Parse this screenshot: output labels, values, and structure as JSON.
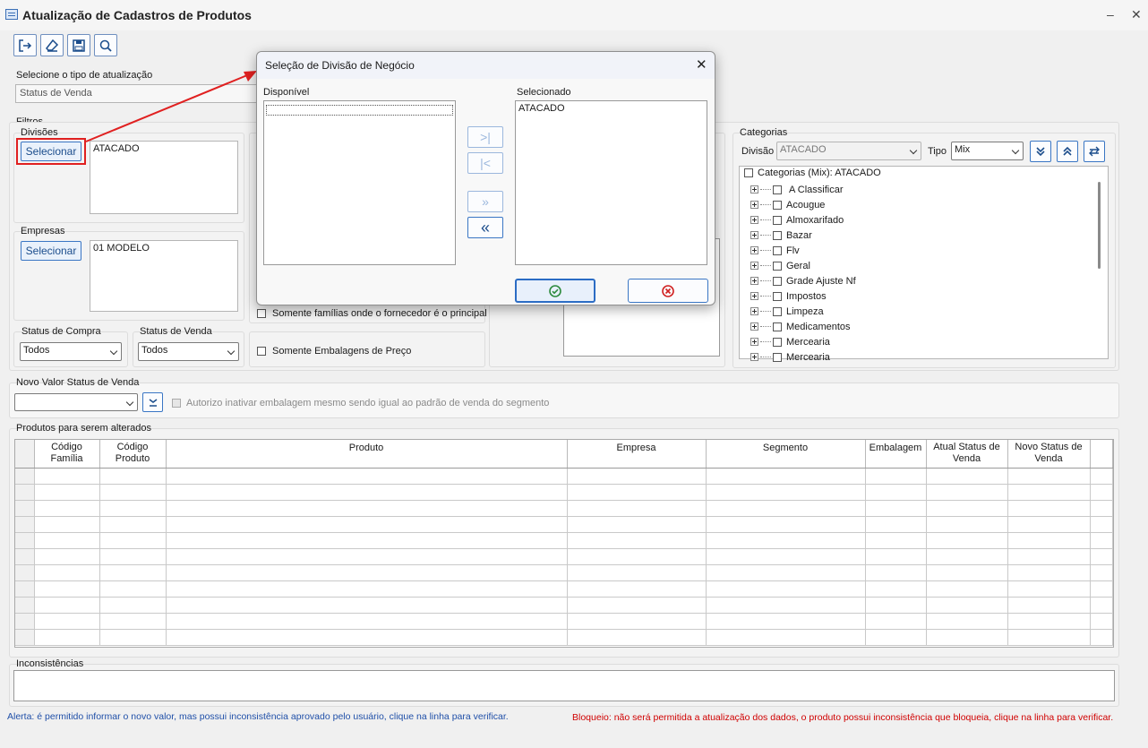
{
  "window": {
    "title": "Atualização de Cadastros de Produtos",
    "minimize": "–",
    "close": "✕"
  },
  "toolbar": {
    "icons": [
      "exit-icon",
      "eraser-icon",
      "save-icon",
      "search-icon"
    ]
  },
  "update_type": {
    "label": "Selecione o tipo de atualização",
    "value": "Status de Venda"
  },
  "filters": {
    "label": "Filtros",
    "divisions": {
      "label": "Divisões",
      "button": "Selecionar",
      "items": [
        "ATACADO"
      ]
    },
    "companies": {
      "label": "Empresas",
      "button": "Selecionar",
      "items": [
        "01 MODELO"
      ]
    },
    "purchase_status": {
      "label": "Status de Compra",
      "value": "Todos"
    },
    "sale_status": {
      "label": "Status de Venda",
      "value": "Todos"
    },
    "check_families": "Somente famílias onde o fornecedor é o principal",
    "check_packaging": "Somente Embalagens de Preço"
  },
  "categories": {
    "label": "Categorias",
    "division_label": "Divisão",
    "division_value": "ATACADO",
    "type_label": "Tipo",
    "type_value": "Mix",
    "root": "Categorias (Mix): ATACADO",
    "items": [
      "A Classificar",
      "Acougue",
      "Almoxarifado",
      "Bazar",
      "Flv",
      "Geral",
      "Grade Ajuste Nf",
      "Impostos",
      "Limpeza",
      "Medicamentos",
      "Mercearia",
      "Mercearia"
    ]
  },
  "new_value": {
    "label": "Novo Valor Status de Venda",
    "value": "",
    "check_label": "Autorizo inativar embalagem mesmo sendo igual ao padrão de venda do segmento"
  },
  "products": {
    "label": "Produtos para serem alterados",
    "columns": [
      "Código Família",
      "Código Produto",
      "Produto",
      "Empresa",
      "Segmento",
      "Embalagem",
      "Atual Status de Venda",
      "Novo Status de Venda"
    ],
    "row_count": 11
  },
  "inconsistencies": {
    "label": "Inconsistências"
  },
  "footer": {
    "alert": "Alerta: é permitido informar o novo valor, mas possui inconsistência aprovado pelo usuário, clique na linha para verificar.",
    "block": "Bloqueio: não será permitida a atualização dos dados, o produto possui inconsistência que bloqueia, clique na linha para verificar.",
    "alert_color": "#1f4fa8",
    "block_color": "#d00000"
  },
  "dialog": {
    "title": "Seleção de Divisão de Negócio",
    "available_label": "Disponível",
    "available_items": [],
    "selected_label": "Selecionado",
    "selected_items": [
      "ATACADO"
    ],
    "close": "✕"
  },
  "highlight_color": "#e02020"
}
